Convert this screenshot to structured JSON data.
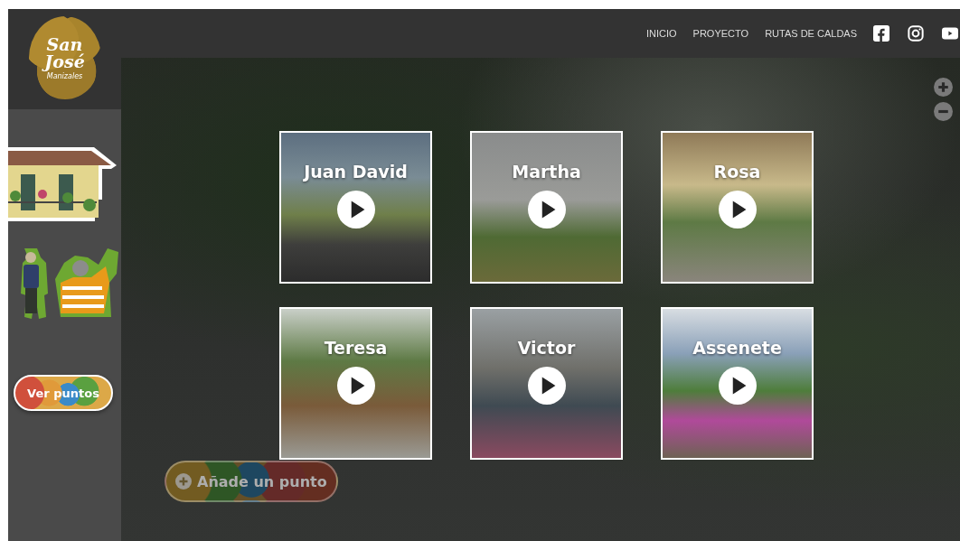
{
  "logo": {
    "lines": [
      "San",
      "José"
    ],
    "subtitle": "Manizales"
  },
  "nav": [
    {
      "label": "INICIO"
    },
    {
      "label": "PROYECTO"
    },
    {
      "label": "RUTAS DE CALDAS"
    }
  ],
  "social": [
    {
      "kind": "facebook"
    },
    {
      "kind": "instagram"
    },
    {
      "kind": "youtube"
    }
  ],
  "zoom_controls": [
    {
      "kind": "plus"
    },
    {
      "kind": "minus"
    }
  ],
  "sidebar": {
    "view_points_button": "Ver puntos"
  },
  "add_point_button": "Añade un punto",
  "stories": [
    {
      "name": "Juan David"
    },
    {
      "name": "Martha"
    },
    {
      "name": "Rosa"
    },
    {
      "name": "Teresa"
    },
    {
      "name": "Victor"
    },
    {
      "name": "Assenete"
    }
  ]
}
